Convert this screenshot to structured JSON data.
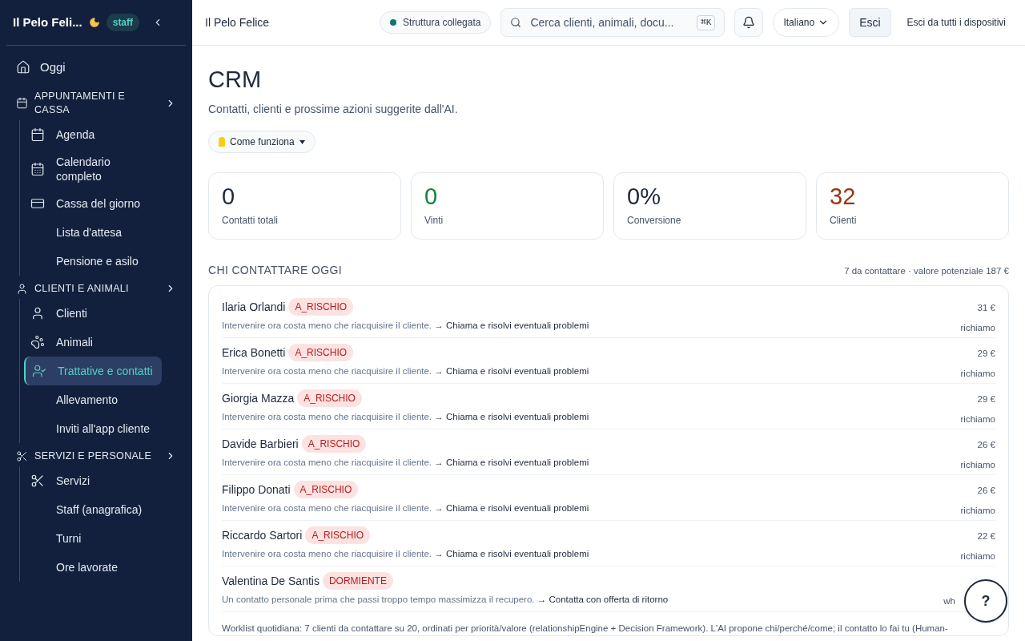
{
  "sidebar": {
    "brand": "Il Pelo Feli...",
    "badge": "staff",
    "top_item": {
      "label": "Oggi",
      "selected": false
    },
    "sections": [
      {
        "title": "APPUNTAMENTI E CASSA",
        "items": [
          {
            "label": "Agenda",
            "selected": false
          },
          {
            "label": "Calendario completo",
            "selected": false
          },
          {
            "label": "Cassa del giorno",
            "selected": false
          },
          {
            "label": "Lista d'attesa",
            "selected": false
          },
          {
            "label": "Pensione e asilo",
            "selected": false
          }
        ]
      },
      {
        "title": "CLIENTI E ANIMALI",
        "items": [
          {
            "label": "Clienti",
            "selected": false
          },
          {
            "label": "Animali",
            "selected": false
          },
          {
            "label": "Trattative e contatti",
            "selected": true
          },
          {
            "label": "Allevamento",
            "selected": false
          },
          {
            "label": "Inviti all'app cliente",
            "selected": false
          }
        ]
      },
      {
        "title": "SERVIZI E PERSONALE",
        "items": [
          {
            "label": "Servizi",
            "selected": false
          },
          {
            "label": "Staff (anagrafica)",
            "selected": false
          },
          {
            "label": "Turni",
            "selected": false
          },
          {
            "label": "Ore lavorate",
            "selected": false
          }
        ]
      }
    ]
  },
  "topbar": {
    "title": "Il Pelo Felice",
    "status": "Struttura collegata",
    "search_placeholder": "Cerca clienti, animali, docu...",
    "shortcut": "⌘K",
    "language": "Italiano",
    "logout": "Esci",
    "logout_all": "Esci da tutti i dispositivi"
  },
  "page": {
    "title": "CRM",
    "subtitle": "Contatti, clienti e prossime azioni suggerite dall'AI.",
    "how_it_works": "Come funziona"
  },
  "stats": [
    {
      "value": "0",
      "label": "Contatti totali",
      "color": "#1e293b"
    },
    {
      "value": "0",
      "label": "Vinti",
      "color": "#15803d"
    },
    {
      "value": "0%",
      "label": "Conversione",
      "color": "#1e293b"
    },
    {
      "value": "32",
      "label": "Clienti",
      "color": "#9a3412"
    }
  ],
  "worklist": {
    "title": "CHI CONTATTARE OGGI",
    "summary": "7 da contattare · valore potenziale 187 €",
    "rows": [
      {
        "name": "Ilaria Orlandi",
        "tag": "A_RISCHIO",
        "reason": "Intervenire ora costa meno che riacquisire il cliente.",
        "action": "→ Chiama e risolvi eventuali problemi",
        "value": "31 €",
        "channel": "richiamo"
      },
      {
        "name": "Erica Bonetti",
        "tag": "A_RISCHIO",
        "reason": "Intervenire ora costa meno che riacquisire il cliente.",
        "action": "→ Chiama e risolvi eventuali problemi",
        "value": "29 €",
        "channel": "richiamo"
      },
      {
        "name": "Giorgia Mazza",
        "tag": "A_RISCHIO",
        "reason": "Intervenire ora costa meno che riacquisire il cliente.",
        "action": "→ Chiama e risolvi eventuali problemi",
        "value": "29 €",
        "channel": "richiamo"
      },
      {
        "name": "Davide Barbieri",
        "tag": "A_RISCHIO",
        "reason": "Intervenire ora costa meno che riacquisire il cliente.",
        "action": "→ Chiama e risolvi eventuali problemi",
        "value": "26 €",
        "channel": "richiamo"
      },
      {
        "name": "Filippo Donati",
        "tag": "A_RISCHIO",
        "reason": "Intervenire ora costa meno che riacquisire il cliente.",
        "action": "→ Chiama e risolvi eventuali problemi",
        "value": "26 €",
        "channel": "richiamo"
      },
      {
        "name": "Riccardo Sartori",
        "tag": "A_RISCHIO",
        "reason": "Intervenire ora costa meno che riacquisire il cliente.",
        "action": "→ Chiama e risolvi eventuali problemi",
        "value": "22 €",
        "channel": "richiamo"
      },
      {
        "name": "Valentina De Santis",
        "tag": "DORMIENTE",
        "reason": "Un contatto personale prima che passi troppo tempo massimizza il recupero.",
        "action": "→ Contatta con offerta di ritorno",
        "channel": "wh"
      }
    ],
    "note": "Worklist quotidiana: 7 clienti da contattare su 20, ordinati per priorità/valore (relationshipEngine + Decision Framework). L'AI propone chi/perché/come; il contatto lo fai tu (Human-"
  },
  "help_button": "?"
}
